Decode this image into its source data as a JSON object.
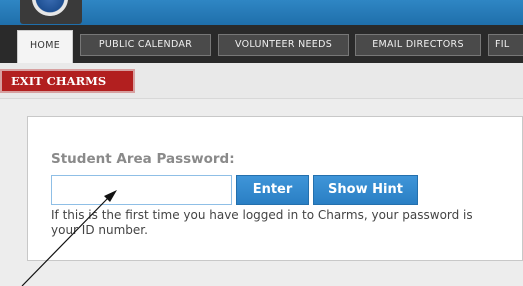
{
  "nav": {
    "tabs": [
      {
        "label": "HOME"
      },
      {
        "label": "PUBLIC CALENDAR"
      },
      {
        "label": "VOLUNTEER NEEDS"
      },
      {
        "label": "EMAIL DIRECTORS"
      },
      {
        "label": "FIL"
      }
    ]
  },
  "toolbar": {
    "exit_label": "EXIT CHARMS"
  },
  "login": {
    "label": "Student Area Password:",
    "password_value": "",
    "enter_label": "Enter",
    "hint_label": "Show Hint",
    "help_text": "If this is the first time you have logged in to Charms, your password is your ID number."
  },
  "colors": {
    "header_blue": "#2f86c4",
    "nav_dark": "#2a2a2a",
    "exit_red": "#b21f1f",
    "button_blue": "#2a7fc4"
  },
  "icons": {
    "logo": "charms-logo-icon",
    "annotation": "pointer-arrow-icon"
  }
}
